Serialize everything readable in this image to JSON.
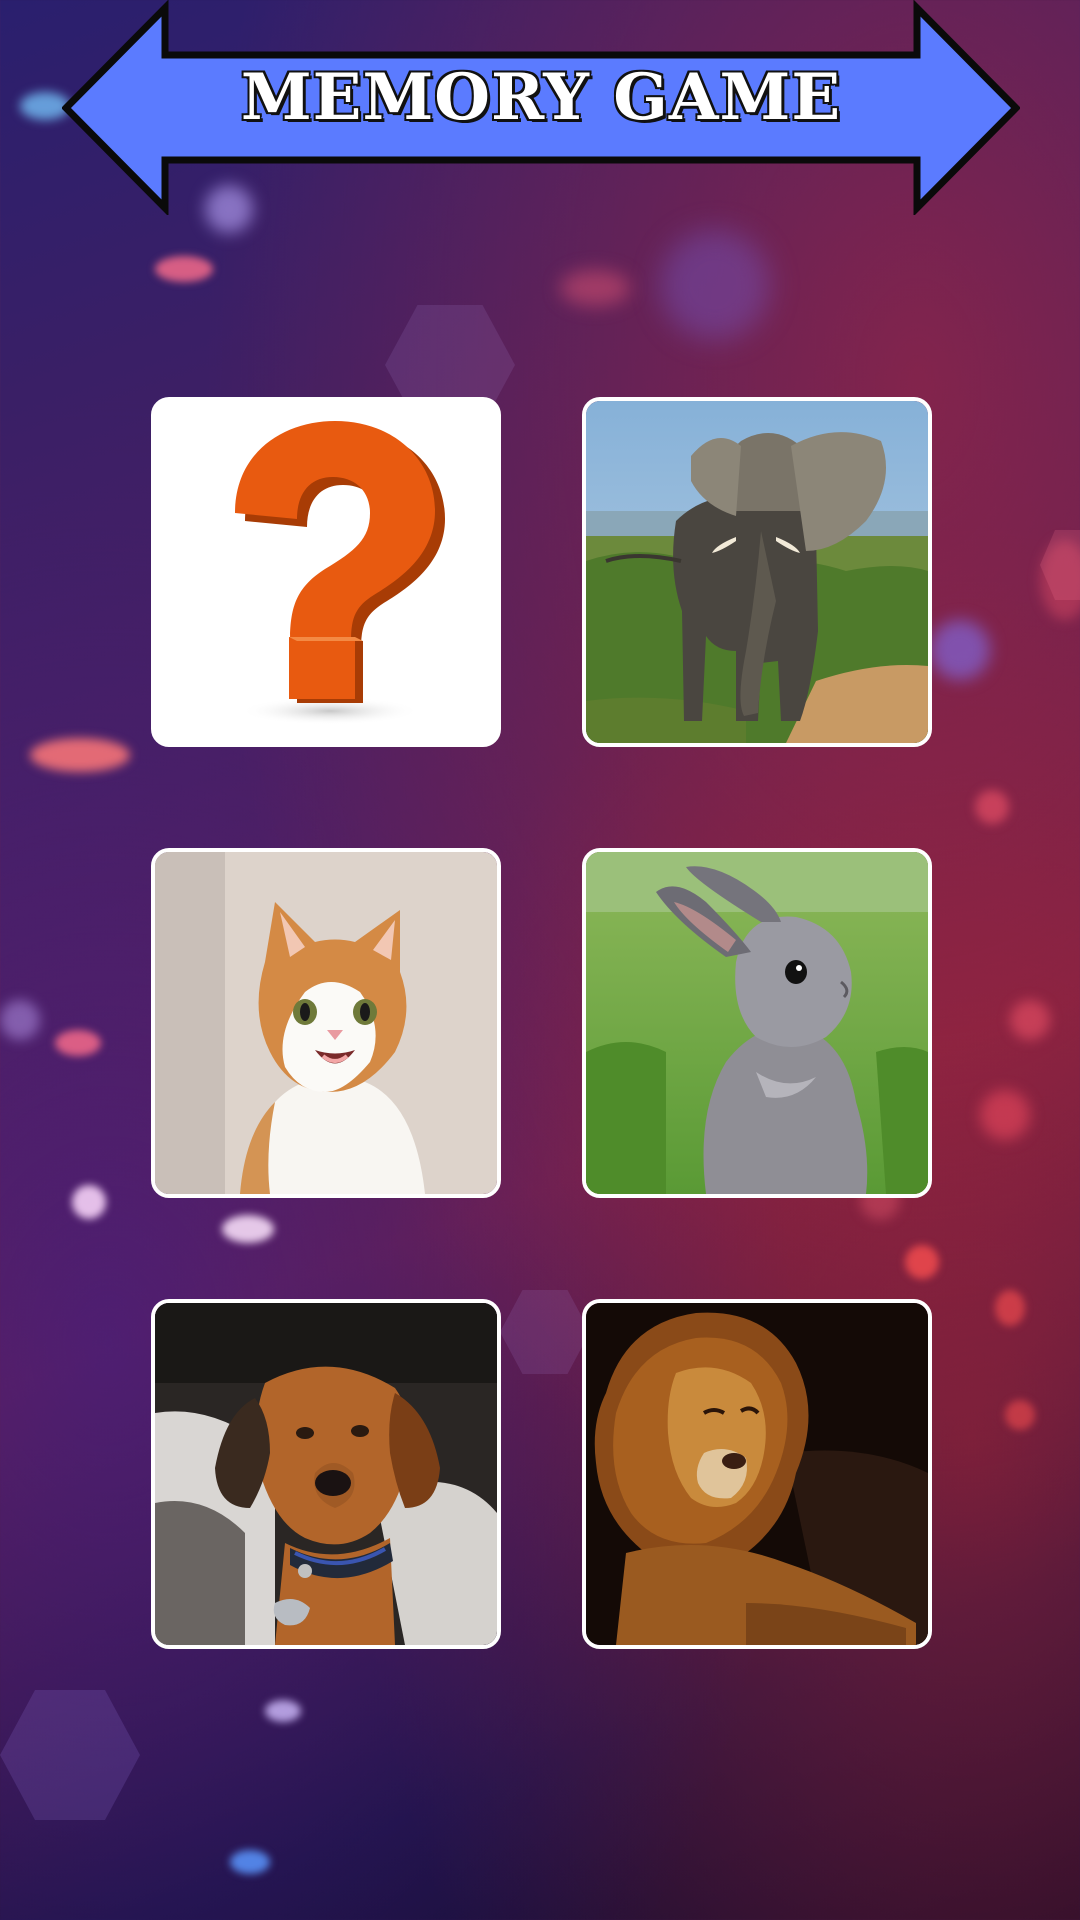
{
  "title": "MEMORY GAME",
  "colors": {
    "banner_fill": "#5b7bff",
    "banner_stroke": "#0a0a0a",
    "card_border": "#ffffff",
    "question_mark": "#e85a10"
  },
  "cards": [
    {
      "state": "hidden",
      "icon": "question-mark-icon"
    },
    {
      "state": "revealed",
      "icon": "elephant-image"
    },
    {
      "state": "revealed",
      "icon": "cat-image"
    },
    {
      "state": "revealed",
      "icon": "rabbit-image"
    },
    {
      "state": "revealed",
      "icon": "dog-image"
    },
    {
      "state": "revealed",
      "icon": "lion-image"
    }
  ]
}
